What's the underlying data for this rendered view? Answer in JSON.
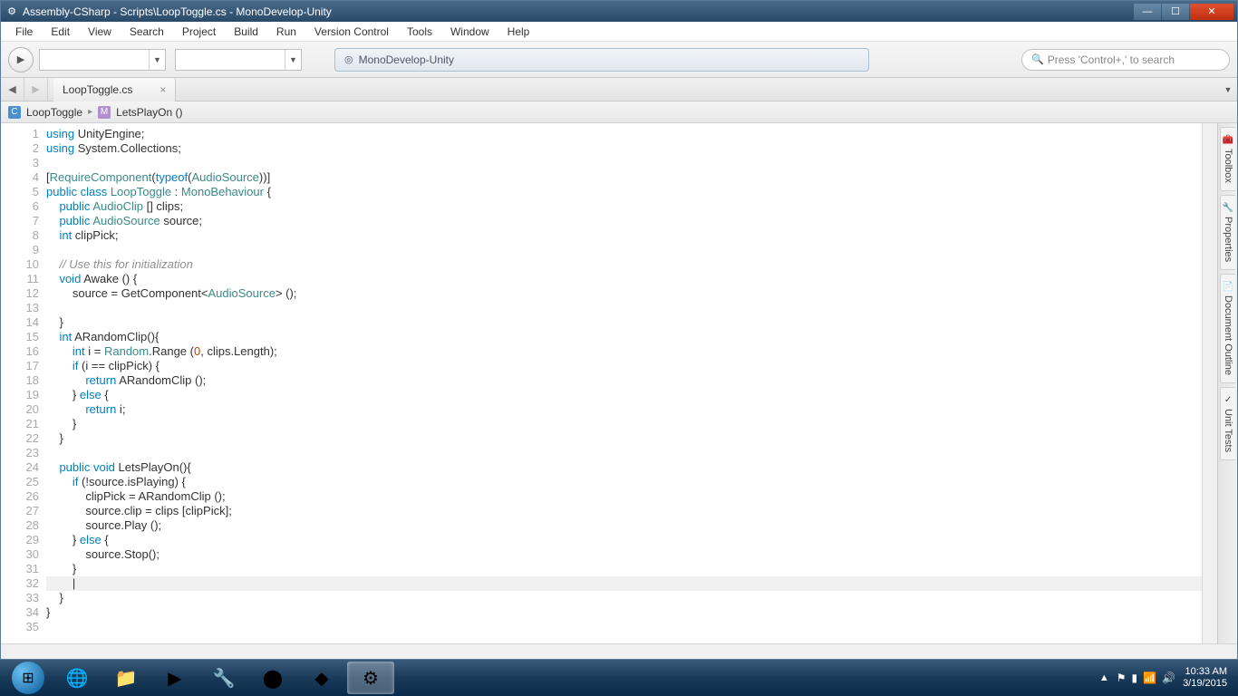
{
  "titlebar": {
    "text": "Assembly-CSharp - Scripts\\LoopToggle.cs - MonoDevelop-Unity"
  },
  "menu": {
    "items": [
      "File",
      "Edit",
      "View",
      "Search",
      "Project",
      "Build",
      "Run",
      "Version Control",
      "Tools",
      "Window",
      "Help"
    ]
  },
  "toolbar": {
    "target": "MonoDevelop-Unity",
    "search_placeholder": "Press 'Control+,' to search"
  },
  "tab": {
    "name": "LoopToggle.cs"
  },
  "breadcrumb": {
    "class": "LoopToggle",
    "method": "LetsPlayOn ()"
  },
  "code_lines": [
    {
      "n": 1,
      "html": "<span class='kw'>using</span> UnityEngine;"
    },
    {
      "n": 2,
      "html": "<span class='kw'>using</span> System.Collections;"
    },
    {
      "n": 3,
      "html": ""
    },
    {
      "n": 4,
      "html": "[<span class='at'>RequireComponent</span>(<span class='kw'>typeof</span>(<span class='ty'>AudioSource</span>))]"
    },
    {
      "n": 5,
      "html": "<span class='kw'>public class</span> <span class='ty'>LoopToggle</span> : <span class='ty'>MonoBehaviour</span> {"
    },
    {
      "n": 6,
      "html": "    <span class='kw'>public</span> <span class='ty'>AudioClip</span> [] clips;"
    },
    {
      "n": 7,
      "html": "    <span class='kw'>public</span> <span class='ty'>AudioSource</span> source;"
    },
    {
      "n": 8,
      "html": "    <span class='kw'>int</span> clipPick;"
    },
    {
      "n": 9,
      "html": ""
    },
    {
      "n": 10,
      "html": "    <span class='cmt'>// Use this for initialization</span>"
    },
    {
      "n": 11,
      "html": "    <span class='kw'>void</span> Awake () {"
    },
    {
      "n": 12,
      "html": "        source = GetComponent&lt;<span class='ty'>AudioSource</span>&gt; ();"
    },
    {
      "n": 13,
      "html": ""
    },
    {
      "n": 14,
      "html": "    }"
    },
    {
      "n": 15,
      "html": "    <span class='kw'>int</span> ARandomClip(){"
    },
    {
      "n": 16,
      "html": "        <span class='kw'>int</span> i = <span class='ty'>Random</span>.Range (<span class='num'>0</span>, clips.Length);"
    },
    {
      "n": 17,
      "html": "        <span class='kw'>if</span> (i == clipPick) {"
    },
    {
      "n": 18,
      "html": "            <span class='kw'>return</span> ARandomClip ();"
    },
    {
      "n": 19,
      "html": "        } <span class='kw'>else</span> {"
    },
    {
      "n": 20,
      "html": "            <span class='kw'>return</span> i;"
    },
    {
      "n": 21,
      "html": "        }"
    },
    {
      "n": 22,
      "html": "    }"
    },
    {
      "n": 23,
      "html": ""
    },
    {
      "n": 24,
      "html": "    <span class='kw'>public void</span> LetsPlayOn(){"
    },
    {
      "n": 25,
      "html": "        <span class='kw'>if</span> (!source.isPlaying) {"
    },
    {
      "n": 26,
      "html": "            clipPick = ARandomClip ();"
    },
    {
      "n": 27,
      "html": "            source.clip = clips [clipPick];"
    },
    {
      "n": 28,
      "html": "            source.Play ();"
    },
    {
      "n": 29,
      "html": "        } <span class='kw'>else</span> {"
    },
    {
      "n": 30,
      "html": "            source.Stop();"
    },
    {
      "n": 31,
      "html": "        }"
    },
    {
      "n": 32,
      "html": "        |",
      "current": true
    },
    {
      "n": 33,
      "html": "    }"
    },
    {
      "n": 34,
      "html": "}"
    },
    {
      "n": 35,
      "html": ""
    }
  ],
  "side_tabs": [
    "Toolbox",
    "Properties",
    "Document Outline",
    "Unit Tests"
  ],
  "systray": {
    "time": "10:33 AM",
    "date": "3/19/2015"
  }
}
